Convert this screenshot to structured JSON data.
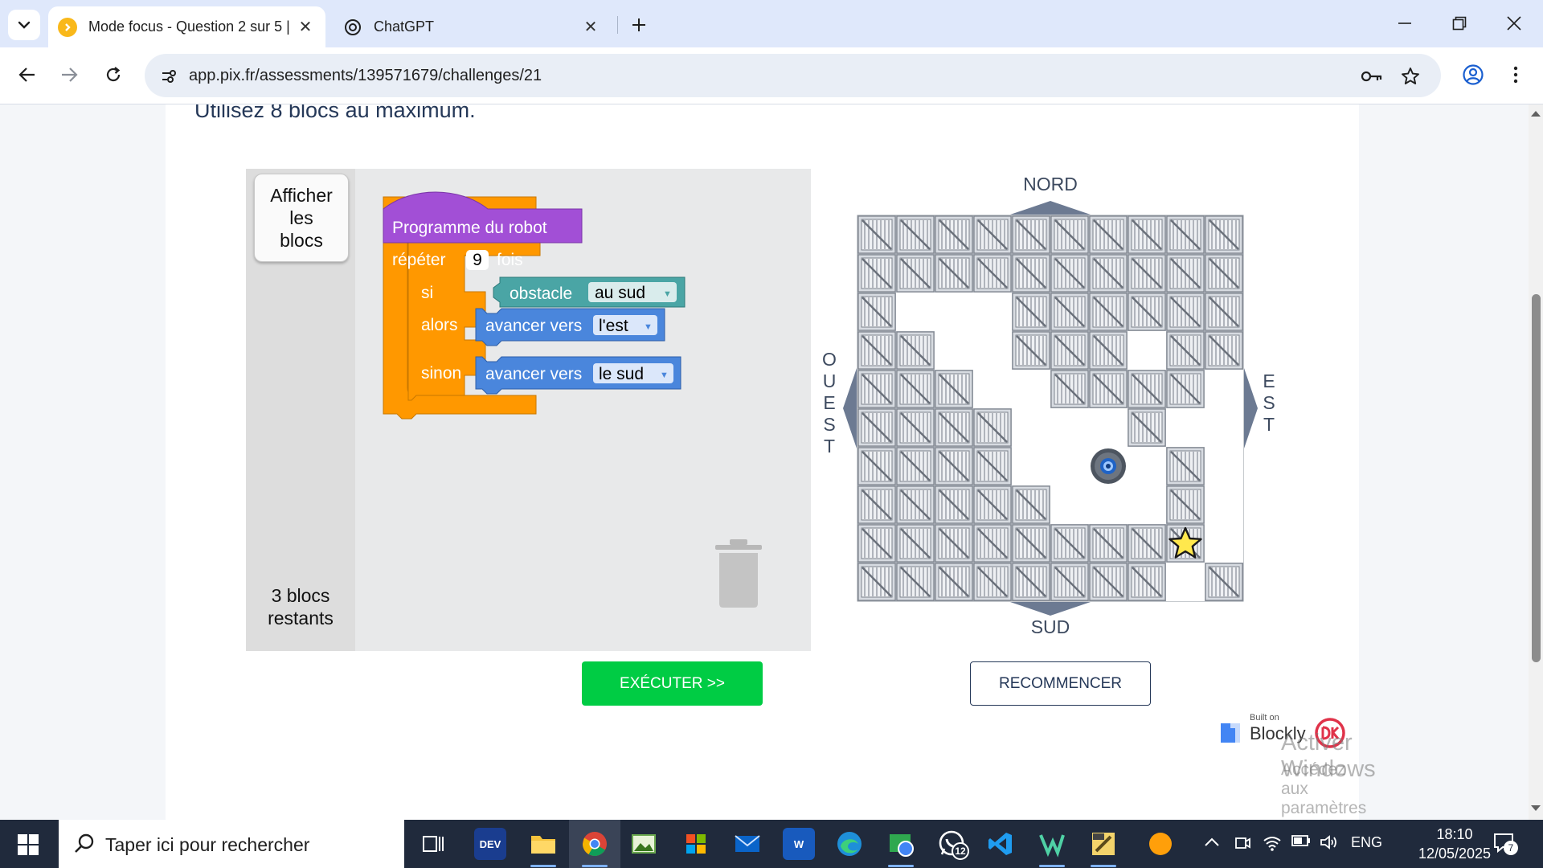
{
  "browser": {
    "tabs": [
      {
        "title": "Mode focus - Question 2 sur 5 |",
        "active": true,
        "favicon": "pix-chevron-icon"
      },
      {
        "title": "ChatGPT",
        "active": false,
        "favicon": "openai-icon"
      }
    ],
    "url": "app.pix.fr/assessments/139571679/challenges/21"
  },
  "page": {
    "instruction": "Utilisez 8 blocs au maximum.",
    "toolbox": {
      "show_blocks_line1": "Afficher",
      "show_blocks_line2": "les",
      "show_blocks_line3": "blocs",
      "remaining_line1": "3 blocs",
      "remaining_line2": "restants"
    },
    "program": {
      "hat_label": "Programme du robot",
      "repeat_label": "répéter",
      "repeat_count": "9",
      "repeat_suffix": "fois",
      "if_label": "si",
      "then_label": "alors",
      "else_label": "sinon",
      "condition_label": "obstacle",
      "condition_value": "au sud",
      "then_action": "avancer vers",
      "then_direction": "l'est",
      "else_action": "avancer vers",
      "else_direction": "le sud"
    },
    "maze": {
      "north": "NORD",
      "south": "SUD",
      "west_letters": [
        "O",
        "U",
        "E",
        "S",
        "T"
      ],
      "east_letters": [
        "E",
        "S",
        "T"
      ],
      "open_cells": [
        [
          2,
          1
        ],
        [
          2,
          2
        ],
        [
          2,
          3
        ],
        [
          3,
          2
        ],
        [
          3,
          3
        ],
        [
          3,
          7
        ],
        [
          4,
          3
        ],
        [
          4,
          4
        ],
        [
          4,
          9
        ],
        [
          5,
          4
        ],
        [
          5,
          5
        ],
        [
          5,
          6
        ],
        [
          5,
          8
        ],
        [
          5,
          9
        ],
        [
          6,
          4
        ],
        [
          6,
          5
        ],
        [
          6,
          6
        ],
        [
          6,
          7
        ],
        [
          6,
          9
        ],
        [
          7,
          5
        ],
        [
          7,
          6
        ],
        [
          7,
          7
        ],
        [
          7,
          9
        ],
        [
          8,
          9
        ],
        [
          9,
          8
        ]
      ],
      "robot_cell": [
        6,
        6
      ],
      "goal_cell": [
        8,
        8
      ]
    },
    "buttons": {
      "run": "EXÉCUTER >>",
      "reset": "RECOMMENCER"
    },
    "built_on_small": "Built on",
    "built_on_big": "Blockly",
    "watermark_title": "Activer Windows",
    "watermark_sub": "Accédez aux paramètres pour activer Windows."
  },
  "taskbar": {
    "search_placeholder": "Taper ici pour rechercher",
    "whatsapp_badge": "12",
    "language": "ENG",
    "time": "18:10",
    "date": "12/05/2025",
    "notification_count": "7"
  },
  "colors": {
    "tabbar_bg": "#dfe8fb",
    "hat_block": "#a24fd6",
    "loop_block": "#ff9800",
    "logic_block": "#4aa5a5",
    "action_block": "#4a86dc",
    "run_button": "#00cc44",
    "text_navy": "#253858"
  }
}
